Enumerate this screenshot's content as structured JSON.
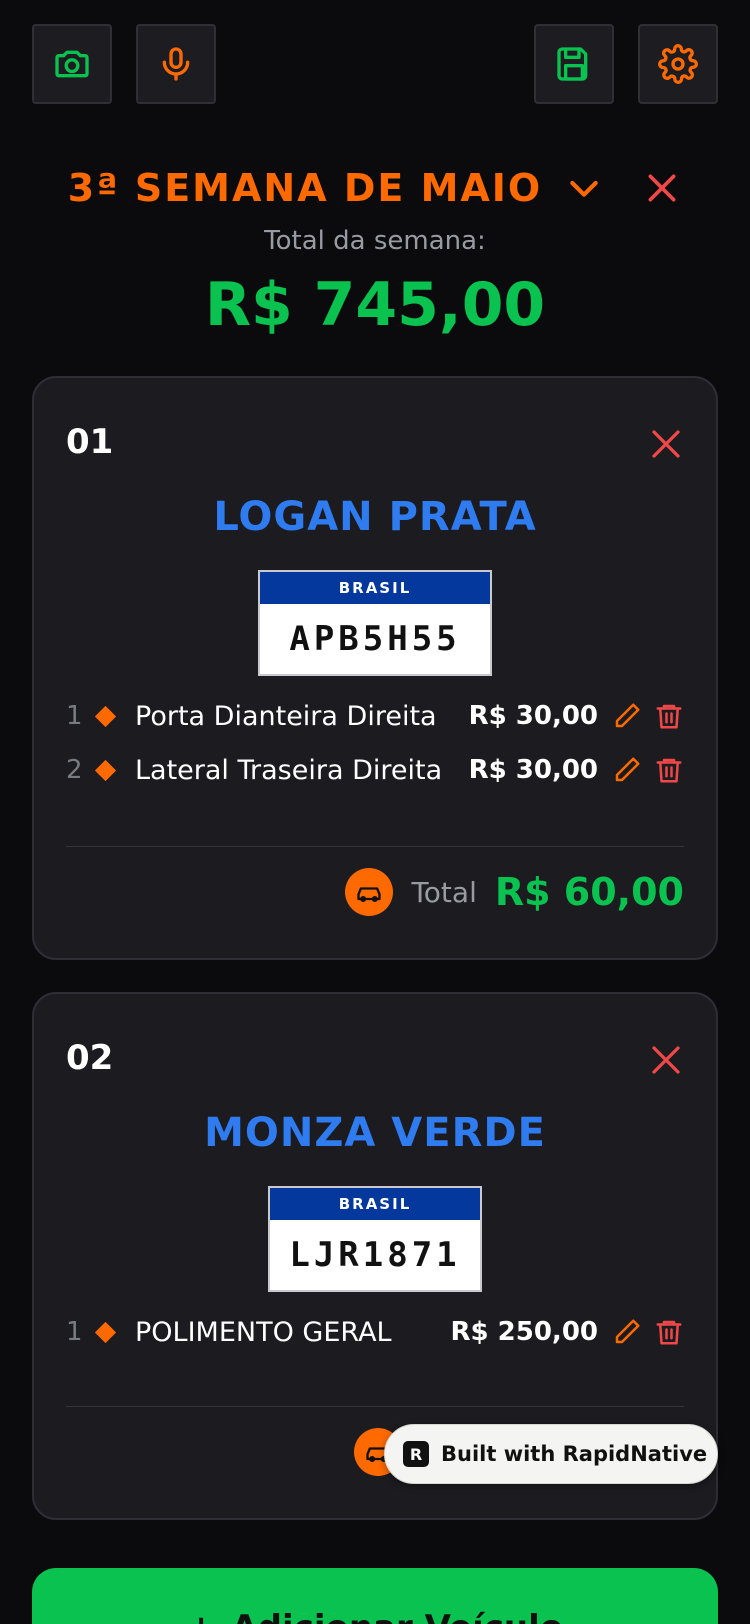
{
  "toolbar": {
    "camera_icon": "camera-icon",
    "mic_icon": "microphone-icon",
    "save_icon": "save-icon",
    "settings_icon": "gear-icon"
  },
  "week": {
    "title": "3ª SEMANA DE MAIO",
    "label": "Total da semana:",
    "total": "R$ 745,00"
  },
  "vehicles": [
    {
      "number": "01",
      "name": "LOGAN PRATA",
      "plate_country": "BRASIL",
      "plate": "APB5H55",
      "services": [
        {
          "index": "1",
          "name": "Porta Dianteira Direita",
          "price": "R$ 30,00"
        },
        {
          "index": "2",
          "name": "Lateral Traseira Direita",
          "price": "R$ 30,00"
        }
      ],
      "total_label": "Total",
      "total": "R$ 60,00"
    },
    {
      "number": "02",
      "name": "MONZA VERDE",
      "plate_country": "BRASIL",
      "plate": "LJR1871",
      "services": [
        {
          "index": "1",
          "name": "POLIMENTO GERAL",
          "price": "R$ 250,00"
        }
      ]
    }
  ],
  "badge": {
    "text": "Built with RapidNative"
  },
  "add_button": {
    "label": "Adicionar Veículo"
  },
  "colors": {
    "background": "#0b0b0e",
    "card": "#1b1b20",
    "accent_orange": "#ff6a00",
    "accent_green": "#0ac24f",
    "accent_blue": "#2f7bf0",
    "danger_red": "#f04848"
  }
}
